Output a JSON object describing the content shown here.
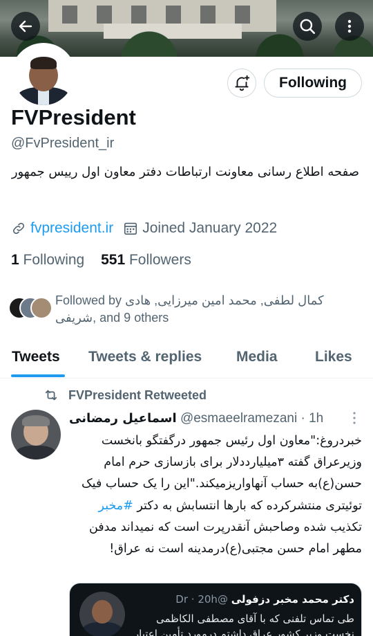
{
  "header": {
    "back_icon": "arrow-left-icon",
    "search_icon": "search-icon",
    "more_icon": "more-vertical-icon"
  },
  "profile": {
    "display_name": "FVPresident",
    "handle": "@FvPresident_ir",
    "bio": "صفحه اطلاع رسانی معاونت ارتباطات دفتر معاون اول رییس جمهور",
    "link": "fvpresident.ir",
    "joined": "Joined January 2022",
    "following_count": "1",
    "following_label": "Following",
    "followers_count": "551",
    "followers_label": "Followers",
    "follow_button_label": "Following",
    "notify_icon": "bell-plus-icon",
    "link_icon": "link-icon",
    "calendar_icon": "calendar-icon"
  },
  "followed_by": {
    "prefix": "Followed by",
    "names": "کمال لطفی, محمد امین میرزایی, هادی شریفی",
    "suffix": ", and 9 others"
  },
  "tabs": [
    {
      "label": "Tweets",
      "active": true
    },
    {
      "label": "Tweets & replies",
      "active": false
    },
    {
      "label": "Media",
      "active": false
    },
    {
      "label": "Likes",
      "active": false
    }
  ],
  "tweet": {
    "retweet_label": "FVPresident Retweeted",
    "author_name": "اسماعیل رمضانی",
    "author_handle": "@esmaeelramezani",
    "time": "· 1h",
    "text_before": "خبردروغ:\"معاون اول رئیس جمهور درگفتگو بانخست وزیرعراق گفته ۳میلیارددلار برای بازسازی حرم امام حسن(ع)به حساب آنهاواریزمیکند.\"این را یک حساب فیک توئیتری منتشرکرده که بارها انتسابش به دکتر ",
    "hashtag": "#مخبر",
    "text_after": " تکذیب شده وصاحبش آنقدرپرت است که نمیداند مدفن مطهر امام حسن مجتبی(ع)درمدینه است نه عراق!",
    "quoted": {
      "author_name": "دکتر محمد مخبر دزفولی",
      "handle_fragment": "@Dr",
      "time": "· 20h",
      "line1": "طی تماس تلفنی که با آقای مصطفی الکاظمی",
      "line2": "نخست وزیر کشور عراق داشتم درمورد تأمین اعتبار"
    }
  }
}
